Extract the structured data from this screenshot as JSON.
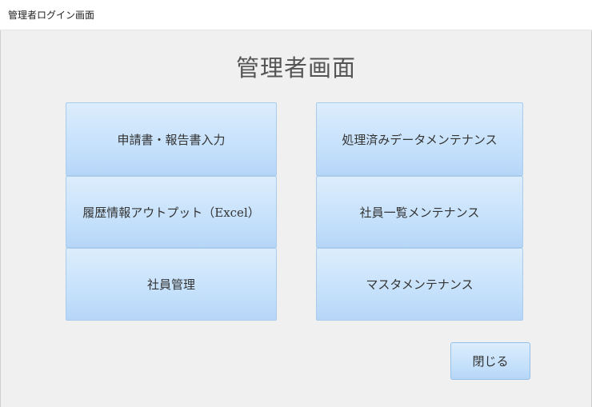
{
  "window": {
    "title": "管理者ログイン画面"
  },
  "page": {
    "title": "管理者画面"
  },
  "menu": {
    "left": [
      "申請書・報告書入力",
      "履歴情報アウトプット（Excel）",
      "社員管理"
    ],
    "right": [
      "処理済みデータメンテナンス",
      "社員一覧メンテナンス",
      "マスタメンテナンス"
    ]
  },
  "actions": {
    "close_label": "閉じる"
  }
}
